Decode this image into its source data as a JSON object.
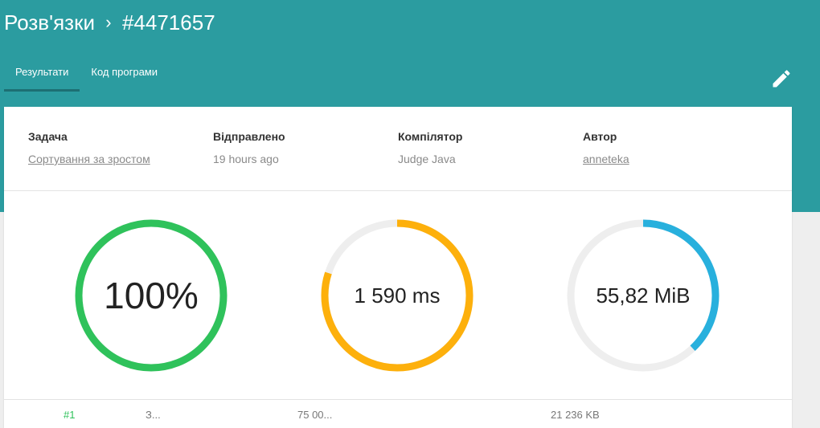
{
  "breadcrumb": {
    "root": "Розв'язки",
    "separator": "›",
    "current": "#4471657"
  },
  "tabs": [
    {
      "label": "Результати",
      "active": true
    },
    {
      "label": "Код програми",
      "active": false
    }
  ],
  "toolbar": {
    "edit_icon": "pencil-icon"
  },
  "meta": {
    "task": {
      "label": "Задача",
      "value": "Сортування за зростом"
    },
    "sent": {
      "label": "Відправлено",
      "value": "19 hours ago"
    },
    "compiler": {
      "label": "Компілятор",
      "value": "Judge Java"
    },
    "author": {
      "label": "Автор",
      "value": "anneteka"
    }
  },
  "gauges": {
    "score": {
      "text": "100%",
      "fraction": 1.0,
      "color": "#2fc25b"
    },
    "time": {
      "text": "1 590 ms",
      "fraction": 0.8,
      "color": "#fdb00c"
    },
    "memory": {
      "text": "55,82 MiB",
      "fraction": 0.38,
      "color": "#28b0dd"
    }
  },
  "colors": {
    "header": "#2b9ca0",
    "track": "#eeeeee"
  },
  "results_peek": {
    "number": "#1",
    "col2": "З...",
    "time": "75 00...",
    "memory": "21 236 KB"
  }
}
